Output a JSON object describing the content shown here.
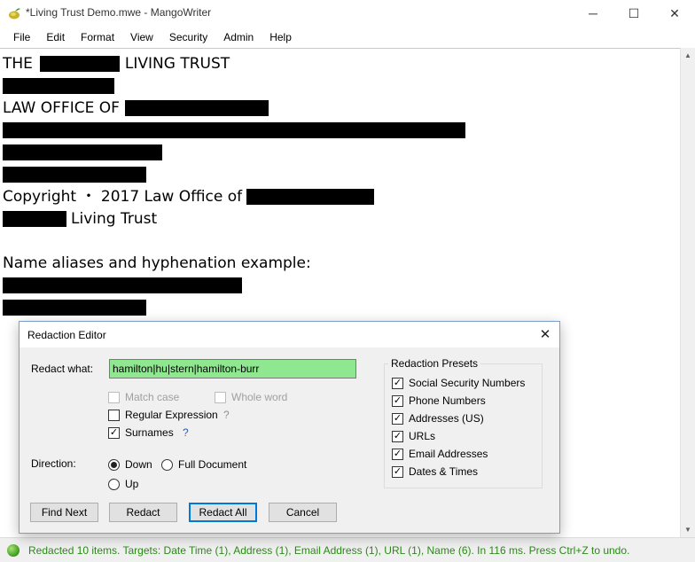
{
  "window": {
    "title": "*Living Trust Demo.mwe - MangoWriter",
    "minimize_glyph": "─",
    "maximize_glyph": "☐",
    "close_glyph": "✕"
  },
  "menu": {
    "items": [
      "File",
      "Edit",
      "Format",
      "View",
      "Security",
      "Admin",
      "Help"
    ]
  },
  "document": {
    "line1_prefix": "THE",
    "line1_suffix": "LIVING TRUST",
    "line3_prefix": "LAW OFFICE OF",
    "copyright_prefix": "Copyright ・ 2017 Law Office of",
    "trust_suffix": "Living Trust",
    "aliases_heading": "Name aliases and hyphenation example:",
    "redaction_color": "#000000"
  },
  "dialog": {
    "title": "Redaction Editor",
    "close_glyph": "✕",
    "redact_what_label": "Redact what:",
    "redact_what_value": "hamilton|hu|stern|hamilton-burr",
    "input_highlight_color": "#8fe88f",
    "options": {
      "match_case": {
        "label": "Match case",
        "checked": false,
        "enabled": false
      },
      "whole_word": {
        "label": "Whole word",
        "checked": false,
        "enabled": false
      },
      "regex": {
        "label": "Regular Expression",
        "checked": false,
        "help": "?"
      },
      "surnames": {
        "label": "Surnames",
        "checked": true,
        "help": "?"
      }
    },
    "direction": {
      "label": "Direction:",
      "down": "Down",
      "full_document": "Full Document",
      "up": "Up",
      "selected": "Down"
    },
    "presets": {
      "title": "Redaction Presets",
      "items": [
        {
          "label": "Social Security Numbers",
          "checked": true
        },
        {
          "label": "Phone Numbers",
          "checked": true
        },
        {
          "label": "Addresses (US)",
          "checked": true
        },
        {
          "label": "URLs",
          "checked": true
        },
        {
          "label": "Email Addresses",
          "checked": true
        },
        {
          "label": "Dates & Times",
          "checked": true
        }
      ]
    },
    "buttons": {
      "find_next": "Find Next",
      "redact": "Redact",
      "redact_all": "Redact All",
      "cancel": "Cancel"
    }
  },
  "status": {
    "text": "Redacted 10 items. Targets: Date  Time (1), Address (1), Email Address (1), URL (1), Name (6). In 116 ms. Press Ctrl+Z to undo.",
    "color": "#2a8a16"
  },
  "scrollbar": {
    "up_glyph": "▲",
    "down_glyph": "▼"
  }
}
